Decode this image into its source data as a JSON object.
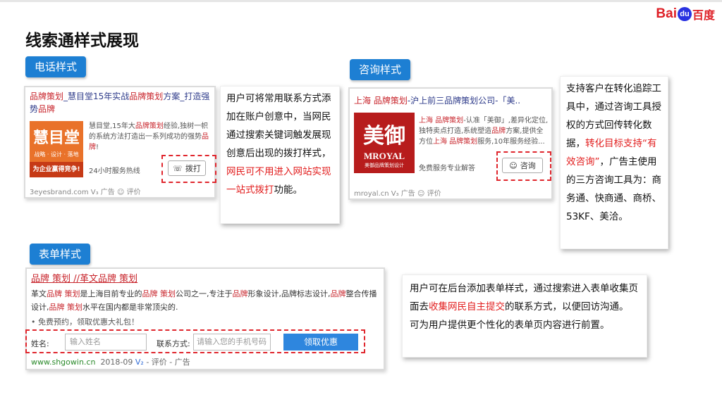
{
  "logo": {
    "bai": "Bai",
    "du": "du",
    "cn": "百度"
  },
  "page_title": "线索通样式展现",
  "phone": {
    "tag": "电话样式",
    "title_parts": [
      "品牌策划",
      "_慧目堂15年实战",
      "品牌策划",
      "方案_打造强势",
      "品牌"
    ],
    "brand_name": "慧目堂",
    "brand_sub": "战略 · 设计 · 落地",
    "brand_slogan": "为企业赢得竞争!",
    "desc_parts": [
      "慧目堂,15年大",
      "品牌策划",
      "经验,独树一帜的系统方法打造出一系列成功的强势",
      "品牌",
      "!"
    ],
    "service": "24小时服务热线",
    "button": "拨打",
    "footer": "3eyesbrand.com  V₃  广告  ☺ 评价"
  },
  "phone_note": {
    "text1": "用户可将常用联系方式添加在账户创意中，当网民通过搜索关键词触发展现创意后出现的拨打样式，",
    "red": "网民可不用进入网站实现一站式拨打",
    "text2": "功能。"
  },
  "consult": {
    "tag": "咨询样式",
    "title_parts": [
      "上海 品牌策划",
      "-沪上前三品牌策划公司-「美.."
    ],
    "brand_name": "美御",
    "brand_en": "MROYAL",
    "brand_cap": "美御品牌策划设计",
    "desc_parts": [
      "上海 品牌策划",
      "-认准「美御」,差异化定位,独特卖点打造,系统塑造",
      "品牌",
      "方案,提供全方位",
      "上海 品牌策划",
      "服务,10年服务经验..."
    ],
    "service": "免费服务专业解答",
    "button": "咨询",
    "footer": "mroyal.cn  V₃  广告  ☺ 评价"
  },
  "consult_note": {
    "text1": "支持客户在转化追踪工具中，通过咨询工具授权的方式回传转化数据，",
    "red": "转化目标支持“有效咨询”",
    "text2": "，广告主使用的三方咨询工具为：商务通、快商通、商桥、53KF、美洽。"
  },
  "form": {
    "tag": "表单样式",
    "title": "品牌 策划 //革文品牌 策划",
    "desc_parts": [
      "革文",
      "品牌 策划",
      "是上海目前专业的",
      "品牌 策划",
      "公司之一,专注于",
      "品牌",
      "形象设计,品牌标志设计,",
      "品牌",
      "整合传播设计,",
      "品牌 策划",
      "水平在国内都是非常顶尖的."
    ],
    "promo": "• 免费预约，领取优惠大礼包！",
    "name_label": "姓名:",
    "name_placeholder": "输入姓名",
    "contact_label": "联系方式:",
    "contact_placeholder": "请输入您的手机号码",
    "submit": "领取优惠",
    "footer_url": "www.shgowin.cn",
    "footer_date": "2018-09",
    "footer_v": "V₂",
    "footer_rest": "- 评价 - 广告"
  },
  "form_note": {
    "text1": "用户可在后台添加表单样式，通过搜索进入表单收集页面去",
    "red": "收集网民自主提交",
    "text2": "的联系方式，以便回访沟通。",
    "text3": "可为用户提供更个性化的表单页内容进行前置。"
  }
}
